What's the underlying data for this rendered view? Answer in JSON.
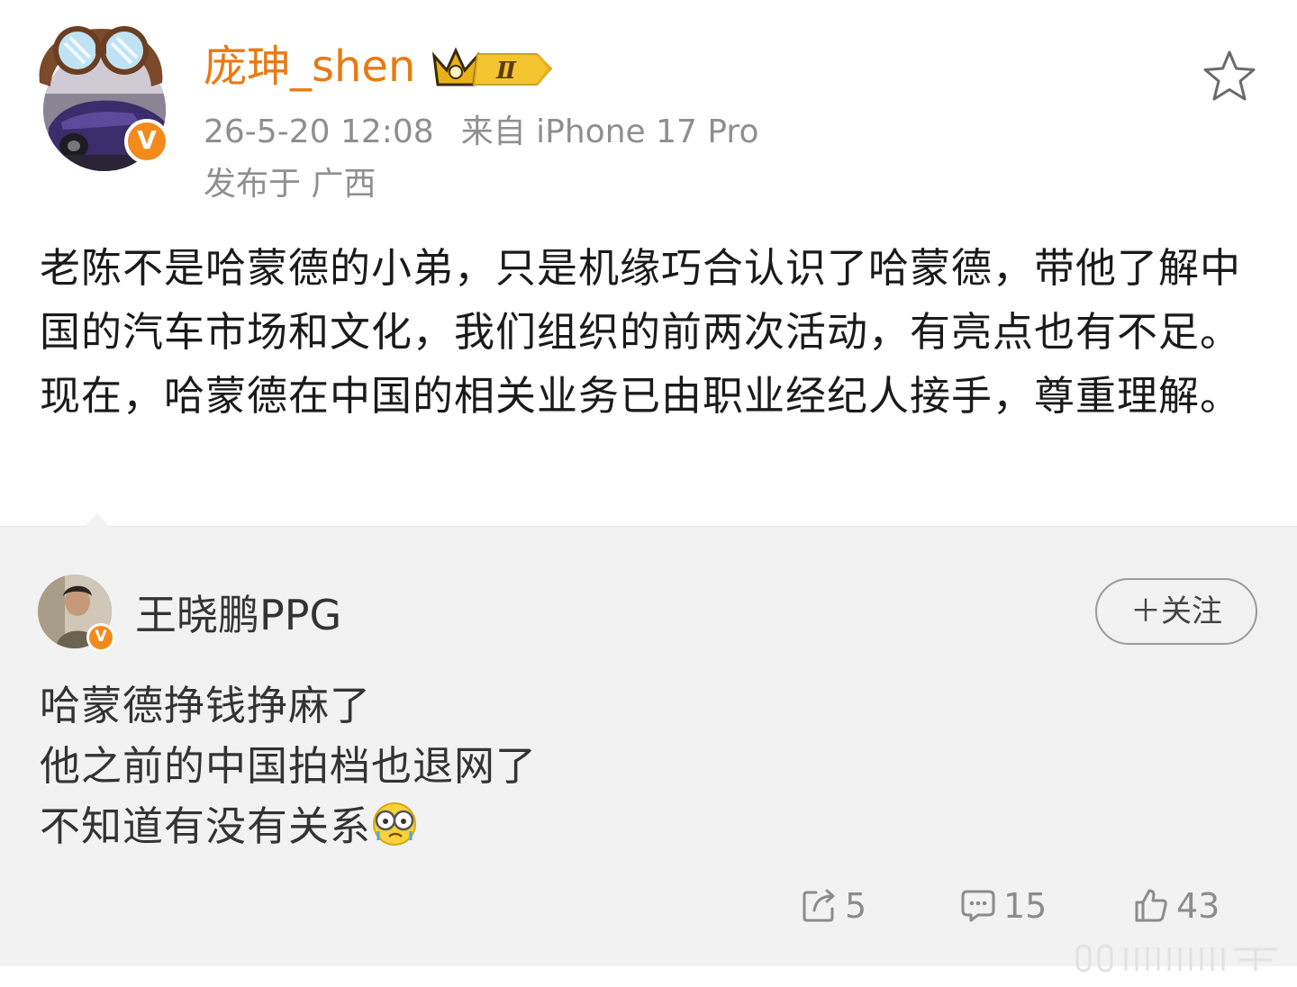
{
  "post": {
    "username": "庞珅_shen",
    "vip_level": "Ⅱ",
    "timestamp": "26-5-20 12:08",
    "source": "来自 iPhone 17 Pro",
    "location": "发布于 广西",
    "text": "老陈不是哈蒙德的小弟，只是机缘巧合认识了哈蒙德，带他了解中国的汽车市场和文化，我们组织的前两次活动，有亮点也有不足。现在，哈蒙德在中国的相关业务已由职业经纪人接手，尊重理解。",
    "verified_mark": "V"
  },
  "quoted": {
    "username": "王晓鹏PPG",
    "verified_mark": "V",
    "follow_label": "＋关注",
    "lines": [
      "哈蒙德挣钱挣麻了",
      "他之前的中国拍档也退网了",
      "不知道有没有关系"
    ],
    "emoji": "doge-sweat-icon",
    "reposts": "5",
    "comments": "15",
    "likes": "43"
  },
  "colors": {
    "username": "#e97a12",
    "verified": "#f28a1c",
    "meta": "#8f8f8f",
    "quoted_bg": "#f2f2f2"
  }
}
